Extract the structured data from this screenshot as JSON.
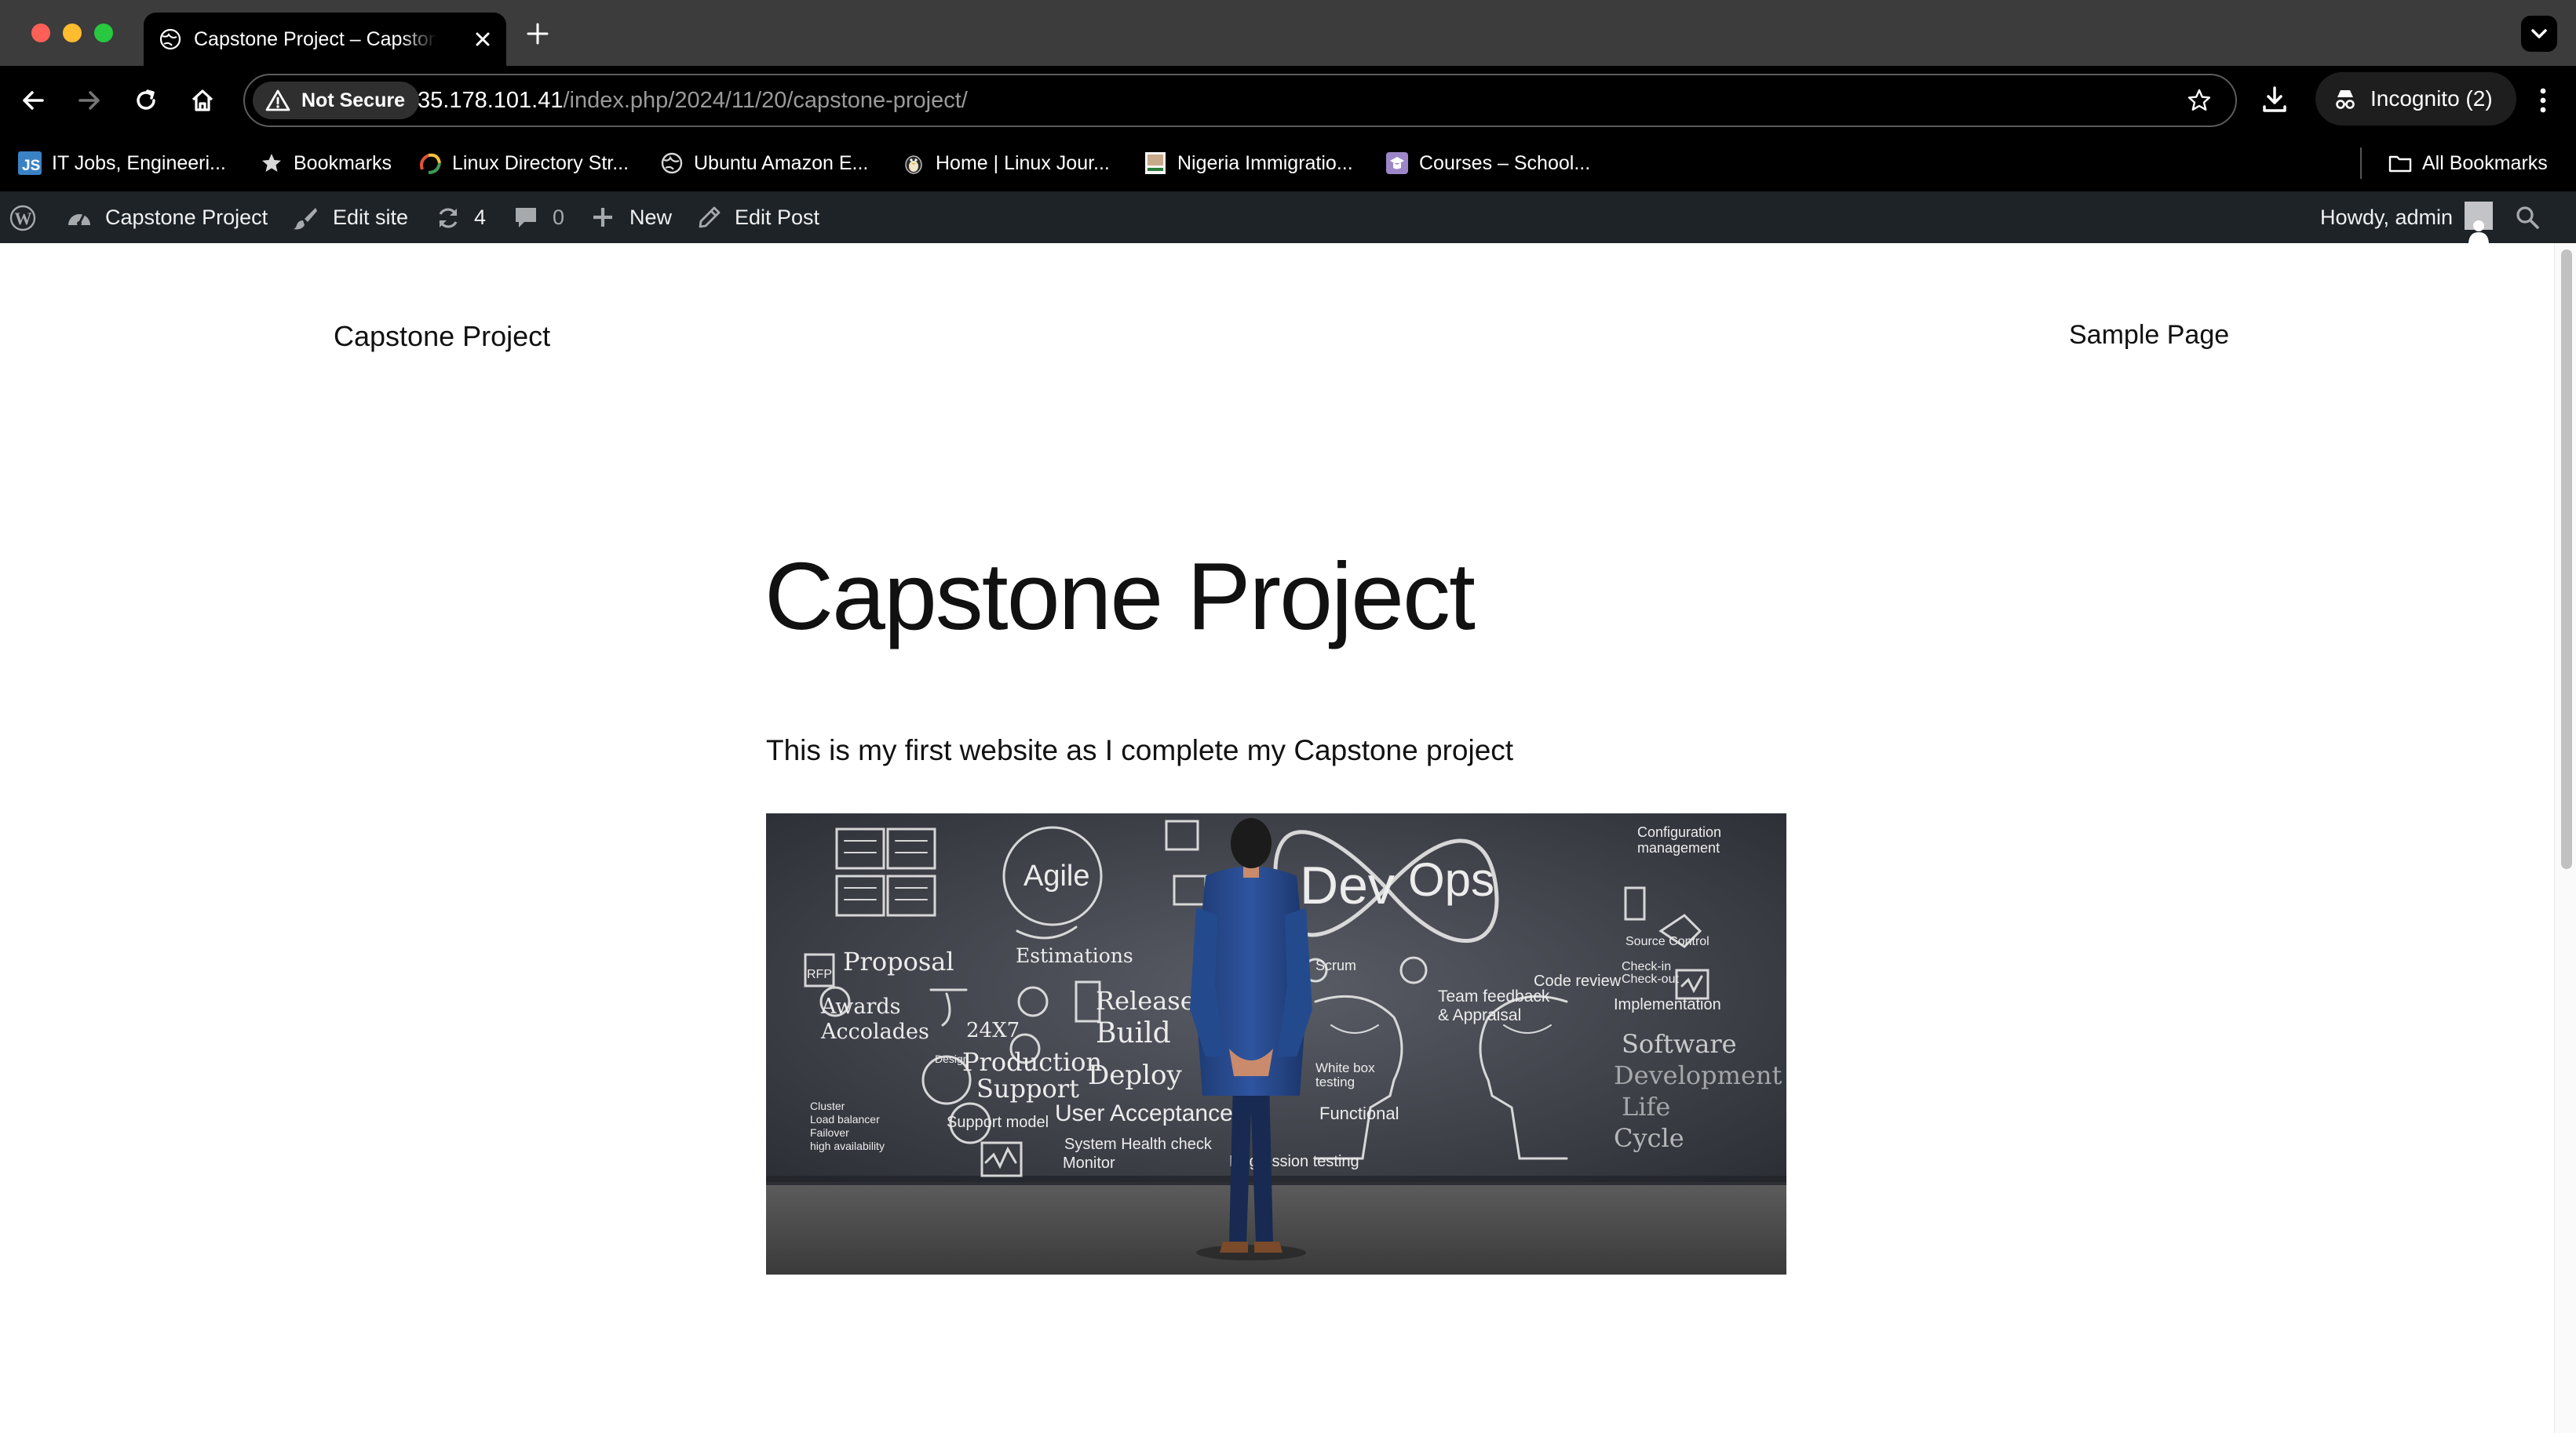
{
  "browser": {
    "tab_title": "Capstone Project – Capstone Project",
    "security_label": "Not Secure",
    "url_host": "35.178.101.41",
    "url_path": "/index.php/2024/11/20/capstone-project/",
    "profile_label": "Incognito (2)",
    "bookmarks": [
      {
        "label": "IT Jobs, Engineeri...",
        "icon": "js-icon"
      },
      {
        "label": "Bookmarks",
        "icon": "star-icon"
      },
      {
        "label": "Linux Directory Str...",
        "icon": "linux-icon"
      },
      {
        "label": "Ubuntu Amazon E...",
        "icon": "globe-icon"
      },
      {
        "label": "Home | Linux Jour...",
        "icon": "penguin-icon"
      },
      {
        "label": "Nigeria Immigratio...",
        "icon": "nigeria-icon"
      },
      {
        "label": "Courses – School...",
        "icon": "school-icon"
      }
    ],
    "all_bookmarks_label": "All Bookmarks"
  },
  "adminbar": {
    "site_name": "Capstone Project",
    "edit_site": "Edit site",
    "updates_count": "4",
    "comments_count": "0",
    "new_label": "New",
    "edit_post": "Edit Post",
    "howdy": "Howdy, admin"
  },
  "page": {
    "site_title": "Capstone Project",
    "nav_item": "Sample Page",
    "post_title": "Capstone Project",
    "post_text": "This is my first website as I complete my Capstone project"
  },
  "image": {
    "chalk_labels": [
      "Agile",
      "Dev",
      "Ops",
      "Proposal",
      "Awards",
      "Accolades",
      "Estimations",
      "Release",
      "Build",
      "Deploy",
      "Production",
      "Support",
      "User Acceptance",
      "Support model",
      "System Health check",
      "Monitor",
      "Software",
      "Development",
      "Life",
      "Cycle",
      "Code review",
      "Implementation",
      "Team feedback & Appraisal",
      "Scrum",
      "RFP",
      "24X7",
      "Cluster",
      "Load balancer",
      "Failover",
      "high availability",
      "Configuration management",
      "Source Control",
      "Check-in Check-out",
      "Design",
      "White box testing",
      "Functional",
      "Regression testing"
    ]
  },
  "colors": {
    "chrome_dark": "#3c3c3c",
    "toolbar": "#000000",
    "adminbar": "#1d2327",
    "page_text": "#111111",
    "chalkboard": "#3a3c44"
  }
}
